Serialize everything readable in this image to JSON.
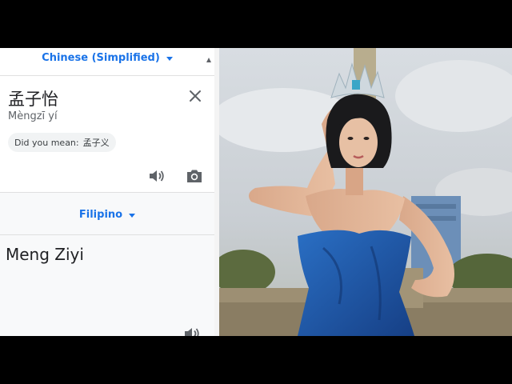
{
  "source": {
    "language": "Chinese (Simplified)",
    "text": "孟子怡",
    "romanization": "Mèngzī yí",
    "did_you_mean_label": "Did you mean:",
    "did_you_mean_value": "孟子义"
  },
  "target": {
    "language": "Filipino",
    "text": "Meng Ziyi"
  },
  "colors": {
    "accent": "#1a73e8",
    "text": "#202124",
    "secondary": "#5f6368",
    "dress": "#1e5fb4"
  },
  "icons": [
    "close-icon",
    "speaker-icon",
    "camera-icon",
    "chevron-down-icon"
  ]
}
